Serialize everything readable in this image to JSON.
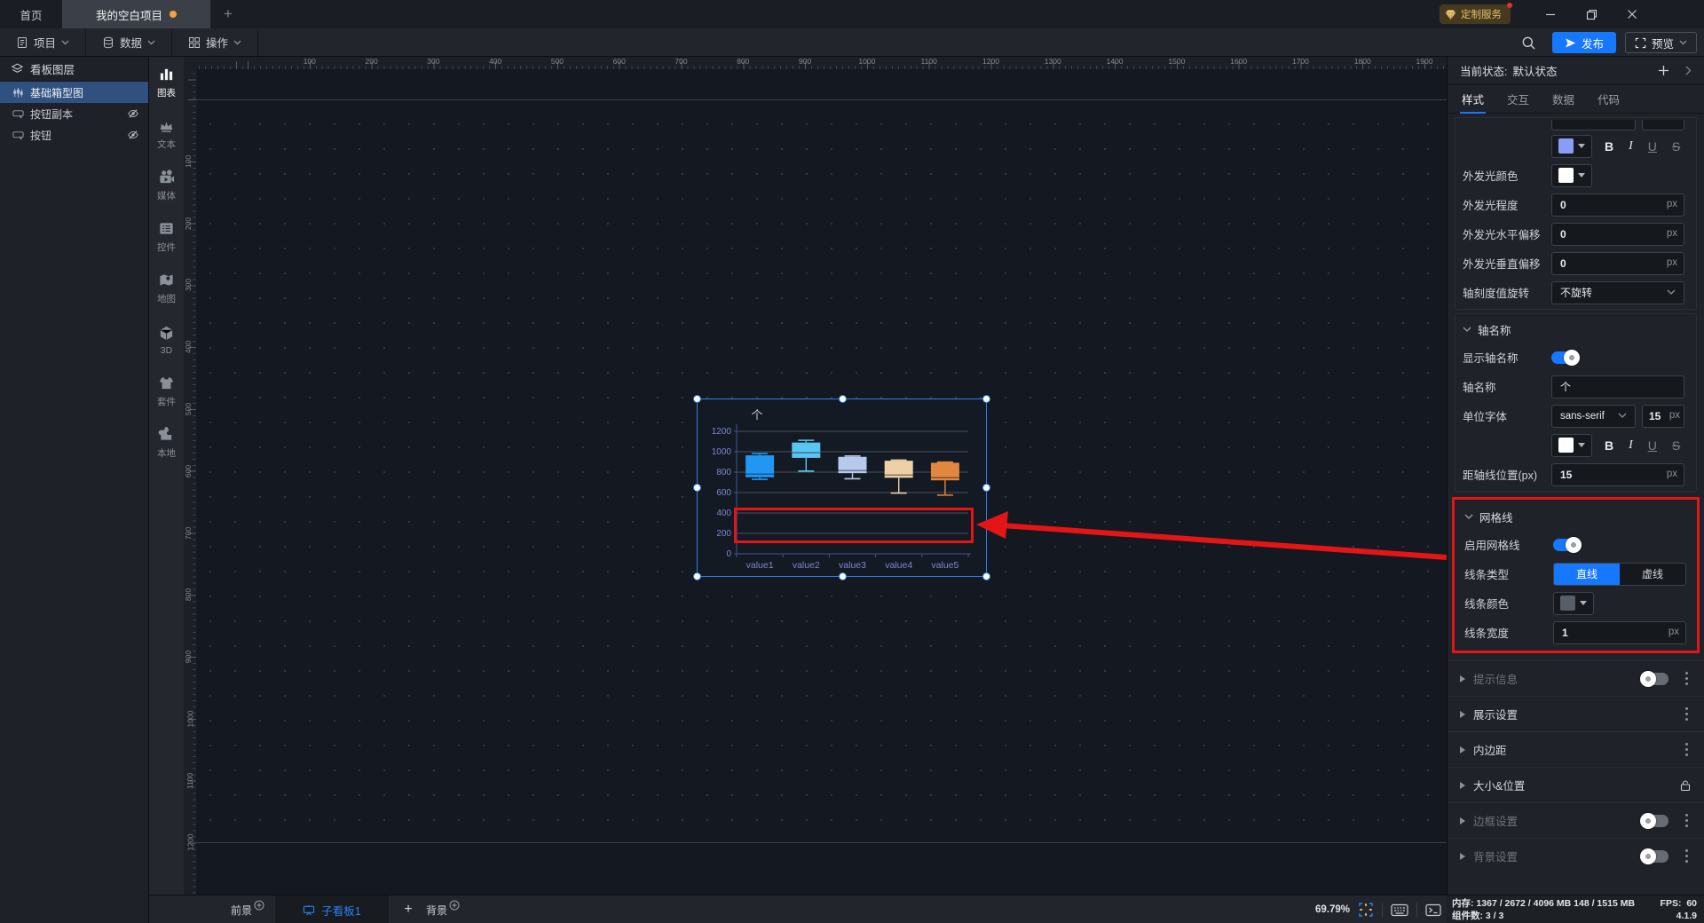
{
  "titlebar": {
    "home": "首页",
    "project_tab": "我的空白项目",
    "custom_service": "定制服务"
  },
  "menubar": {
    "project": "项目",
    "data": "数据",
    "ops": "操作",
    "publish": "发布",
    "preview": "预览"
  },
  "layers": {
    "title": "看板图层",
    "items": [
      {
        "label": "基础箱型图",
        "selected": true,
        "hidden": false
      },
      {
        "label": "按钮副本",
        "selected": false,
        "hidden": true
      },
      {
        "label": "按钮",
        "selected": false,
        "hidden": true
      }
    ]
  },
  "toolbox": {
    "items": [
      "图表",
      "文本",
      "媒体",
      "控件",
      "地图",
      "3D",
      "套件",
      "本地"
    ],
    "active": "图表"
  },
  "canvas": {
    "h_ruler": [
      100,
      200,
      300,
      400,
      500,
      600,
      700,
      800,
      900,
      1000,
      1100,
      1200,
      1300,
      1400,
      1500,
      1600,
      1700,
      1800,
      1900
    ],
    "v_ruler": [
      100,
      200,
      300,
      400,
      500,
      600,
      700,
      800,
      900,
      1000,
      1100,
      1200
    ]
  },
  "chart_data": {
    "type": "boxplot",
    "title": "",
    "axis_name": "个",
    "categories": [
      "value1",
      "value2",
      "value3",
      "value4",
      "value5"
    ],
    "ylim": [
      0,
      1200
    ],
    "ytick_step": 200,
    "grid": true,
    "legend": false,
    "series": [
      {
        "name": "value1",
        "low": 730,
        "q1": 750,
        "median": 780,
        "q3": 965,
        "high": 982,
        "color": "#2196f3"
      },
      {
        "name": "value2",
        "low": 810,
        "q1": 940,
        "median": 990,
        "q3": 1090,
        "high": 1112,
        "color": "#5bc5f2"
      },
      {
        "name": "value3",
        "low": 735,
        "q1": 790,
        "median": 815,
        "q3": 950,
        "high": 958,
        "color": "#b6c8ec"
      },
      {
        "name": "value4",
        "low": 595,
        "q1": 745,
        "median": 772,
        "q3": 912,
        "high": 918,
        "color": "#edd0a4"
      },
      {
        "name": "value5",
        "low": 575,
        "q1": 720,
        "median": 746,
        "q3": 892,
        "high": 898,
        "color": "#e2873f"
      }
    ]
  },
  "right_panel": {
    "state_label": "当前状态:",
    "state_value": "默认状态",
    "tabs": [
      "样式",
      "交互",
      "数据",
      "代码"
    ],
    "px": "px",
    "bius": {
      "b": "B",
      "i": "I",
      "u": "U",
      "s": "S"
    },
    "glow": {
      "font_color": "#8c9bf5",
      "color_label": "外发光颜色",
      "glow_color": "#ffffff",
      "amount_label": "外发光程度",
      "amount": "0",
      "h_offset_label": "外发光水平偏移",
      "h_offset": "0",
      "v_offset_label": "外发光垂直偏移",
      "v_offset": "0",
      "tick_rotate_label": "轴刻度值旋转",
      "tick_rotate": "不旋转"
    },
    "axis_section": {
      "title": "轴名称",
      "show_label": "显示轴名称",
      "name_label": "轴名称",
      "name": "个",
      "unit_font_label": "单位字体",
      "unit_font": "sans-serif",
      "unit_size": "15",
      "unit_color": "#ffffff",
      "offset_label": "距轴线位置(px)",
      "offset": "15"
    },
    "grid_section": {
      "title": "网格线",
      "enable_label": "启用网格线",
      "type_label": "线条类型",
      "type_options": [
        "直线",
        "虚线"
      ],
      "type_active": "直线",
      "color_label": "线条颜色",
      "line_color": "#585e68",
      "width_label": "线条宽度",
      "width": "1"
    },
    "collapsed": [
      {
        "label": "提示信息"
      },
      {
        "label": "展示设置"
      },
      {
        "label": "内边距"
      },
      {
        "label": "大小&位置"
      },
      {
        "label": "边框设置"
      },
      {
        "label": "背景设置"
      }
    ]
  },
  "footer": {
    "foreground": "前景",
    "board_tab": "子看板1",
    "add": "+",
    "background": "背景",
    "zoom": "69.79%"
  },
  "status": {
    "memory_label": "内存:",
    "memory": "1367 / 2672 / 4096 MB  148 / 1515 MB",
    "fps_label": "FPS:",
    "fps": "60",
    "components_label": "组件数:",
    "components": "3 / 3",
    "version": "4.1.9"
  }
}
